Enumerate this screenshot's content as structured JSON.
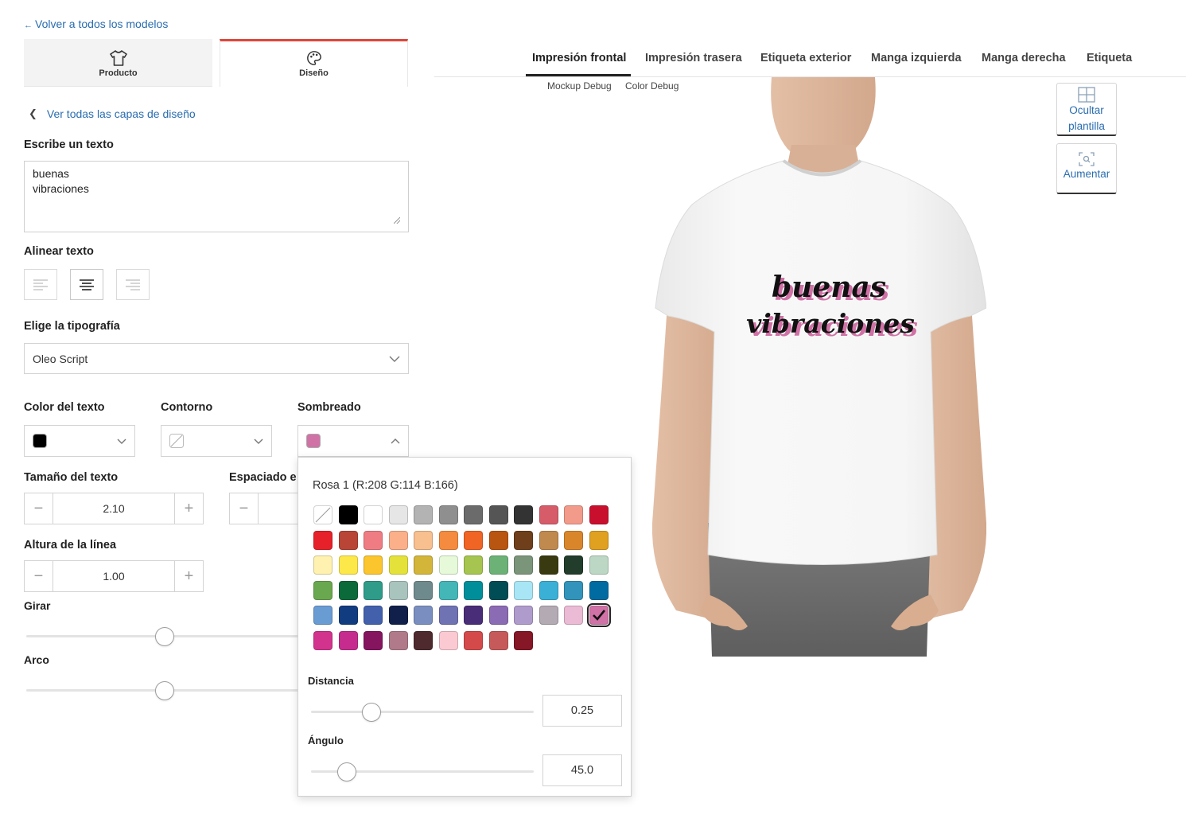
{
  "nav": {
    "back_label": "Volver a todos los modelos"
  },
  "side_tabs": {
    "product": "Producto",
    "design": "Diseño"
  },
  "layers_link": "Ver todas las capas de diseño",
  "text_section": {
    "label": "Escribe un texto",
    "value": "buenas\nvibraciones"
  },
  "align_section": {
    "label": "Alinear texto",
    "selected": "center"
  },
  "font_section": {
    "label": "Elige la tipografía",
    "value": "Oleo Script"
  },
  "color_section": {
    "text_color_label": "Color del texto",
    "text_color": "#000000",
    "outline_label": "Contorno",
    "shadow_label": "Sombreado",
    "shadow_color": "#d072a6"
  },
  "size_section": {
    "label": "Tamaño del texto",
    "value": "2.10",
    "spacing_label": "Espaciado e"
  },
  "line_height_section": {
    "label": "Altura de la línea",
    "value": "1.00"
  },
  "rotate_section": {
    "label": "Girar",
    "level": 0.5
  },
  "arc_section": {
    "label": "Arco",
    "level": 0.5
  },
  "shadow_popover": {
    "title": "Rosa 1 (R:208 G:114 B:166)",
    "palette": [
      "none",
      "#000000",
      "#ffffff",
      "#e6e6e6",
      "#b3b3b3",
      "#8f8f8f",
      "#6b6b6b",
      "#555555",
      "#333333",
      "#d75c6a",
      "#f29b8a",
      "#c8102e",
      "#e62129",
      "#b84536",
      "#f07c83",
      "#fbb08a",
      "#f8bf8f",
      "#f58b3e",
      "#f06424",
      "#b85510",
      "#6e3f1a",
      "#c0894e",
      "#d9862b",
      "#e0a020",
      "#fff2b0",
      "#fde84a",
      "#fbc52e",
      "#e4e23a",
      "#d3b53a",
      "#e6fad9",
      "#a5c550",
      "#6cb277",
      "#7a957a",
      "#3a3a10",
      "#223d2c",
      "#bcd8c4",
      "#6aa84f",
      "#0a6a3a",
      "#2e9c89",
      "#a8c4bd",
      "#6f8a8d",
      "#43b6b8",
      "#008f9a",
      "#004d55",
      "#a8e6f5",
      "#3ab0d6",
      "#3294ba",
      "#006ba0",
      "#6a9cd4",
      "#123c80",
      "#4260ac",
      "#11204a",
      "#7a8fc0",
      "#6f72b3",
      "#4a2d78",
      "#8b6bb3",
      "#b09ccc",
      "#b3aab3",
      "#ebbad4",
      "#d072a6",
      "#d2338c",
      "#c52c8e",
      "#85155f",
      "#b07a8a",
      "#4e2a2e",
      "#fbc9d2",
      "#d44a4a",
      "#c65a5a",
      "#851726"
    ],
    "selected_index": 59,
    "distance_label": "Distancia",
    "distance_value": "0.25",
    "distance_level": 0.27,
    "angle_label": "Ángulo",
    "angle_value": "45.0",
    "angle_level": 0.16
  },
  "view_tabs": [
    "Impresión frontal",
    "Impresión trasera",
    "Etiqueta exterior",
    "Manga izquierda",
    "Manga derecha",
    "Etiqueta"
  ],
  "debug": {
    "mockup": "Mockup Debug",
    "color": "Color Debug"
  },
  "tools": {
    "hide_template": "Ocultar\nplantilla",
    "zoom": "Aumentar"
  },
  "shirt_text": {
    "line1": "buenas",
    "line2": "vibraciones",
    "fill": "#111111",
    "shadow": "#d072a6"
  }
}
